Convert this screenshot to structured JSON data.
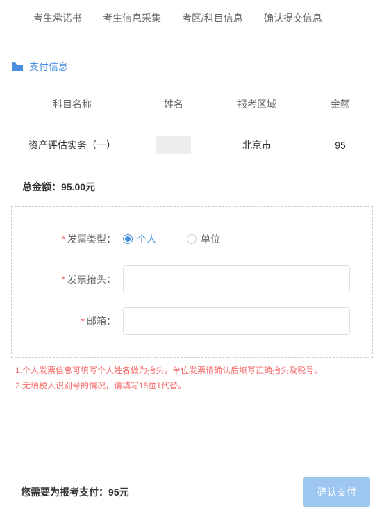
{
  "nav": {
    "tabs": [
      "考生承诺书",
      "考生信息采集",
      "考区/科目信息",
      "确认提交信息"
    ]
  },
  "section": {
    "title": "支付信息"
  },
  "table": {
    "headers": {
      "subject": "科目名称",
      "name": "姓名",
      "region": "报考区域",
      "amount": "金额"
    },
    "rows": [
      {
        "subject": "资产评估实务（一）",
        "name": "",
        "region": "北京市",
        "amount": "95"
      }
    ]
  },
  "total": {
    "label": "总金额：",
    "value": "95.00元"
  },
  "form": {
    "invoice_type": {
      "label": "发票类型：",
      "options": {
        "personal": "个人",
        "company": "单位"
      }
    },
    "invoice_title": {
      "label": "发票抬头："
    },
    "email": {
      "label": "邮箱："
    }
  },
  "notes": {
    "line1": "1.个人发票信息可填写个人姓名做为抬头，单位发票请确认后填写正确抬头及税号。",
    "line2": "2.无纳税人识别号的情况，请填写15位1代替。"
  },
  "footer": {
    "pay_label": "您需要为报考支付：",
    "pay_amount": "95元",
    "confirm_btn": "确认支付"
  }
}
